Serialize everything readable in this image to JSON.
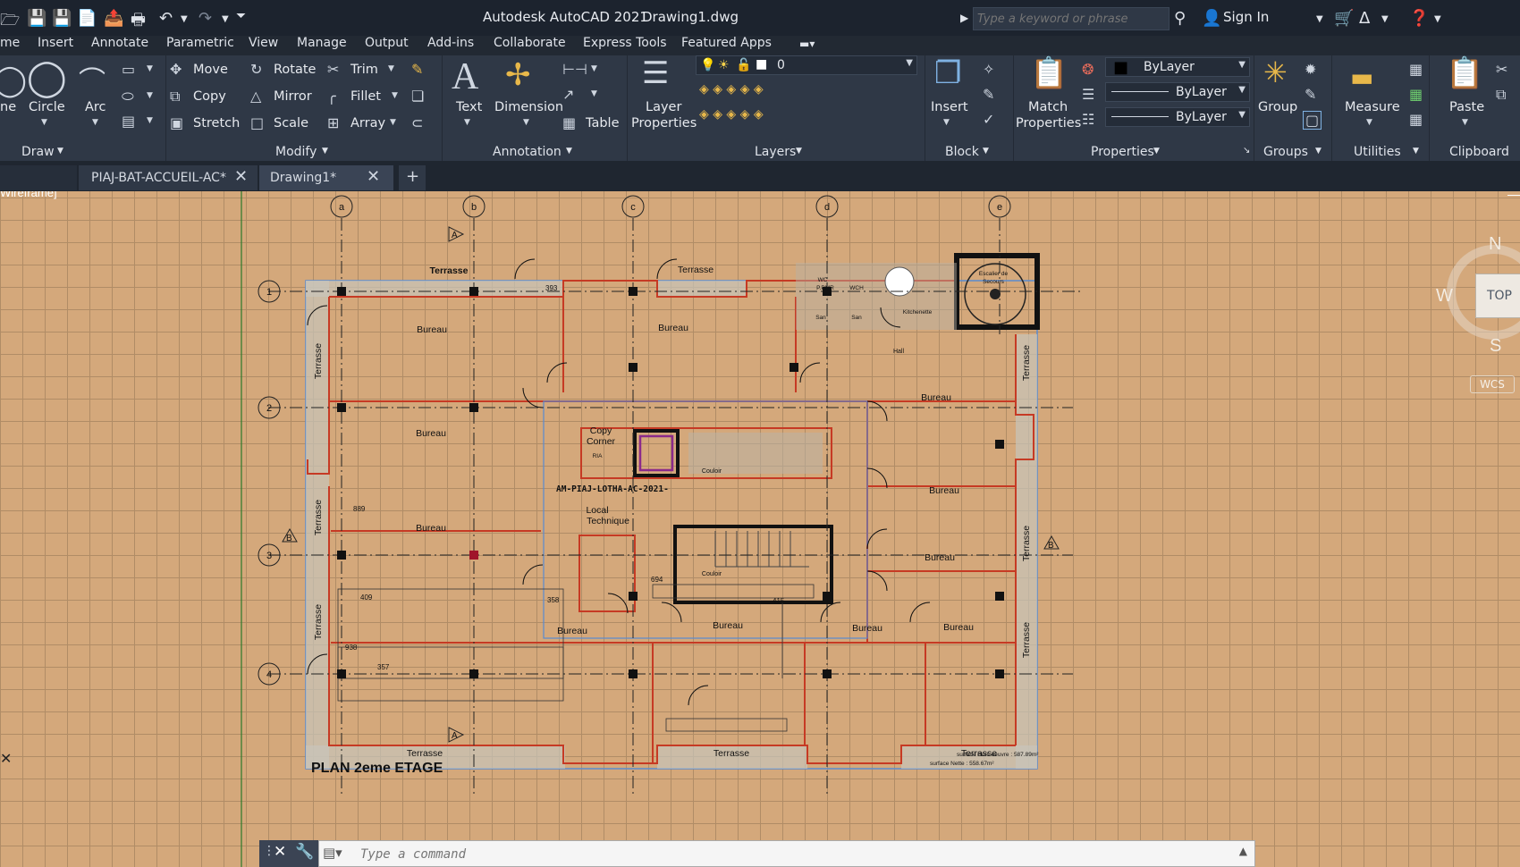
{
  "titlebar": {
    "app_title": "Autodesk AutoCAD 2021",
    "file_name": "Drawing1.dwg",
    "search_placeholder": "Type a keyword or phrase",
    "sign_in": "Sign In"
  },
  "menubar": {
    "items": [
      "me",
      "Insert",
      "Annotate",
      "Parametric",
      "View",
      "Manage",
      "Output",
      "Add-ins",
      "Collaborate",
      "Express Tools",
      "Featured Apps"
    ]
  },
  "ribbon": {
    "draw": {
      "title": "Draw",
      "line": "ne",
      "circle": "Circle",
      "arc": "Arc"
    },
    "modify": {
      "title": "Modify",
      "move": "Move",
      "rotate": "Rotate",
      "trim": "Trim",
      "copy": "Copy",
      "mirror": "Mirror",
      "fillet": "Fillet",
      "stretch": "Stretch",
      "scale": "Scale",
      "array": "Array"
    },
    "annotation": {
      "title": "Annotation",
      "text": "Text",
      "dimension": "Dimension",
      "table": "Table"
    },
    "layers": {
      "title": "Layers",
      "layer_properties_1": "Layer",
      "layer_properties_2": "Properties",
      "current_layer": "0"
    },
    "block": {
      "title": "Block",
      "insert": "Insert"
    },
    "properties": {
      "title": "Properties",
      "match_1": "Match",
      "match_2": "Properties",
      "color": "ByLayer",
      "linetype": "ByLayer",
      "lineweight": "ByLayer"
    },
    "groups": {
      "title": "Groups",
      "group": "Group"
    },
    "utilities": {
      "title": "Utilities",
      "measure": "Measure"
    },
    "clipboard": {
      "title": "Clipboard",
      "paste": "Paste"
    }
  },
  "tabs": [
    {
      "label": "PIAJ-BAT-ACCUEIL-AC*"
    },
    {
      "label": "Drawing1*"
    }
  ],
  "viewport": {
    "view_label": "Wireframe]",
    "viewcube": {
      "top": "TOP",
      "north": "N",
      "south": "S",
      "west": "W",
      "wcs": "WCS"
    }
  },
  "drawing": {
    "grid_cols": [
      "a",
      "b",
      "c",
      "d",
      "e"
    ],
    "grid_rows": [
      "1",
      "2",
      "3",
      "4"
    ],
    "section_marks": [
      "A",
      "A",
      "B",
      "B"
    ],
    "plan_title": "PLAN 2eme ETAGE",
    "surface_1": "surface Hors oeuvre : 587.89m²",
    "surface_2": "surface Nette : 558.67m²",
    "reference": "AM-PIAJ-LOTHA-AC-2021-",
    "labels": {
      "terrasse": "Terrasse",
      "bureau": "Bureau",
      "hall": "Hall",
      "couloir": "Couloir",
      "copy_corner_1": "Copy",
      "copy_corner_2": "Corner",
      "local_1": "Local",
      "local_2": "Technique",
      "kitchenette": "Kitchenette",
      "escalier_1": "Escalier de",
      "escalier_2": "Secours",
      "wc": "WC",
      "wch": "WCH",
      "pmr": "P.PMR",
      "san1": "San",
      "san2": "San",
      "ria": "RIA"
    },
    "dims": [
      "393",
      "889",
      "409",
      "358",
      "694",
      "415",
      "938",
      "357"
    ]
  },
  "command_line": {
    "placeholder": "Type a command"
  }
}
